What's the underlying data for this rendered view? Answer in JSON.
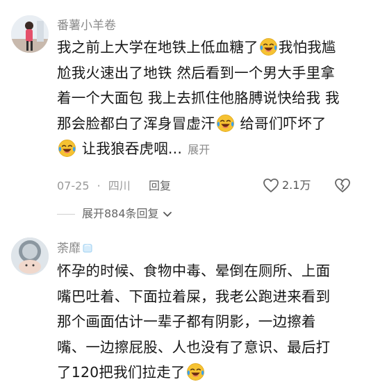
{
  "comments": [
    {
      "username": "番薯小羊卷",
      "avatar_icon": "user-avatar-photo",
      "lines": [
        [
          "我之前上大学在地铁上低血糖了",
          "EMOJI",
          "我怕我尴"
        ],
        [
          "尬我火速出了地铁 然后看到一个男大手里拿"
        ],
        [
          "着一个大面包 我上去抓住他胳膊说快给我 我"
        ],
        [
          "那会脸都白了浑身冒虚汗",
          "EMOJI",
          " 给哥们吓坏了"
        ],
        [
          "EMOJI",
          " 让我狼吞虎咽..."
        ]
      ],
      "expand_label": "展开",
      "date": "07-25",
      "separator": "·",
      "location": "四川",
      "reply_label": "回复",
      "like_count": "2.1万",
      "expand_replies_label": "展开884条回复"
    },
    {
      "username": "荼靡",
      "avatar_icon": "user-avatar-photo",
      "lines": [
        [
          "怀孕的时候、食物中毒、晕倒在厕所、上面"
        ],
        [
          "嘴巴吐着、下面拉着屎，我老公跑进来看到"
        ],
        [
          "那个画面估计一辈子都有阴影，一边擦着"
        ],
        [
          "嘴、一边擦屁股、人也没有了意识、最后打"
        ],
        [
          "了120把我们拉走了",
          "EMOJI"
        ]
      ]
    }
  ],
  "icons": {
    "emoji": "laughing-crying-emoji",
    "like": "heart-outline-icon",
    "dislike": "broken-heart-icon",
    "chevron": "chevron-down-icon",
    "ice": "ice-cube-icon"
  },
  "colors": {
    "text": "#161616",
    "meta": "#999999",
    "emoji_face": "#f6c232",
    "emoji_tear": "#3aa0f0"
  }
}
